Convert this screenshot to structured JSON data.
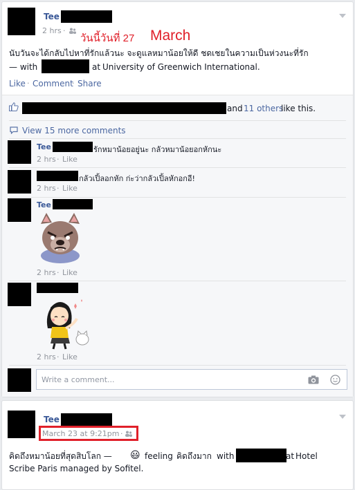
{
  "post1": {
    "author": "Tee",
    "time": "2 hrs",
    "annotation_thai": "วันนี้วันที่ 27",
    "annotation_month": "March",
    "text_thai": "นับวันจะได้กลับไปหาที่รักแล้วนะ จะดูแลหมาน้อยให้ดี ชดเชยในความเป็นห่วงนะที่รัก",
    "text_with_prefix": "— with",
    "text_at": "at",
    "location": "University of Greenwich International.",
    "actions": {
      "like": "Like",
      "comment": "Comment",
      "share": "Share",
      "sep": "·"
    },
    "likes_and": "and",
    "likes_others": "11 others",
    "likes_suffix": "like this.",
    "view_more": "View 15 more comments",
    "comments": [
      {
        "author": "Tee",
        "text": "รักหมาน้อยอยู่นะ กลัวหมาน้อยอกหักนะ",
        "time": "2 hrs",
        "like": "Like"
      },
      {
        "author": "",
        "text": "กลัวเปิ้ลอกหัก ก่ะว่ากลัวเปิ้ลหักอกอี!",
        "time": "2 hrs",
        "like": "Like"
      },
      {
        "author": "Tee",
        "text": "",
        "time": "2 hrs",
        "like": "Like"
      },
      {
        "author": "",
        "text": "",
        "time": "2 hrs",
        "like": "Like"
      }
    ],
    "write_placeholder": "Write a comment..."
  },
  "post2": {
    "author": "Tee",
    "time": "March 23 at 9:21pm",
    "text_thai": "คิดถึงหมาน้อยที่สุดสิบโลก —",
    "feeling_prefix": "feeling",
    "feeling_value": "คิดถึงมาก",
    "with_word": "with",
    "at_word": "at",
    "location_line1": "Hotel",
    "location_line2": "Scribe Paris managed by Sofitel.",
    "emoji": "😃"
  },
  "colors": {
    "link": "#4b67a1",
    "name": "#3b5998",
    "annotation": "#e0202a",
    "meta": "#90949c"
  }
}
